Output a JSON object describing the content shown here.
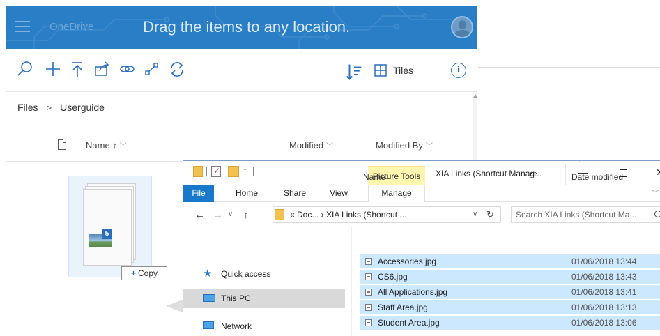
{
  "onedrive": {
    "brand": "OneDrive",
    "drag_message": "Drag the items to any location.",
    "toolbar": {
      "icons": [
        "search-icon",
        "new-icon",
        "upload-icon",
        "share-icon",
        "get-link-icon",
        "embed-icon",
        "sync-icon"
      ],
      "view_label": "Tiles",
      "info_label": "i"
    },
    "breadcrumb": {
      "root": "Files",
      "separator": ">",
      "current": "Userguide"
    },
    "columns": {
      "name": "Name ↑",
      "modified": "Modified",
      "modified_by": "Modified By"
    },
    "drag_preview": {
      "count": "5",
      "copy_label": "Copy",
      "copy_plus": "+"
    }
  },
  "explorer": {
    "quick_access_dropdown": "=",
    "contextual_tab_group": "Picture Tools",
    "title": "XIA Links (Shortcut Manag...",
    "ribbon_tabs": {
      "file": "File",
      "home": "Home",
      "share": "Share",
      "view": "View",
      "manage": "Manage"
    },
    "address": "«  Doc...  ›  XIA Links (Shortcut ...",
    "search_placeholder": "Search XIA Links (Shortcut Ma...",
    "nav": {
      "quick_access": "Quick access",
      "this_pc": "This PC",
      "network": "Network"
    },
    "columns": {
      "name": "Name",
      "date_modified": "Date modified"
    },
    "files": [
      {
        "name": "Accessories.jpg",
        "date": "01/06/2018 13:44"
      },
      {
        "name": "CS6.jpg",
        "date": "01/06/2018 13:43"
      },
      {
        "name": "All Applications.jpg",
        "date": "01/06/2018 13:41"
      },
      {
        "name": "Staff Area.jpg",
        "date": "01/06/2018 13:13"
      },
      {
        "name": "Student Area.jpg",
        "date": "01/06/2018 13:06"
      }
    ]
  },
  "colors": {
    "onedrive_header": "#2a7ec6",
    "accent_blue": "#2a6db8",
    "selection": "#cce8ff",
    "picture_tools": "#fff7b0",
    "file_tab": "#1979ca"
  }
}
